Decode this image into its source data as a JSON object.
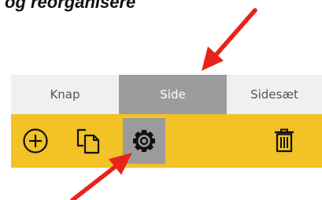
{
  "caption": "og reorganisere",
  "tabs": [
    {
      "label": "Knap",
      "active": false
    },
    {
      "label": "Side",
      "active": true
    },
    {
      "label": "Sidesæt",
      "active": false
    }
  ],
  "toolbar": {
    "background": "#f2c226",
    "buttons": [
      {
        "icon": "plus-circle-icon",
        "active": false
      },
      {
        "icon": "copy-icon",
        "active": false
      },
      {
        "icon": "gear-icon",
        "active": true
      },
      {
        "icon": "trash-icon",
        "active": false
      }
    ]
  },
  "colors": {
    "active_tab": "#9c9c9c",
    "tab_bar": "#f0f0f0",
    "annotation_arrow": "#e8231a"
  }
}
